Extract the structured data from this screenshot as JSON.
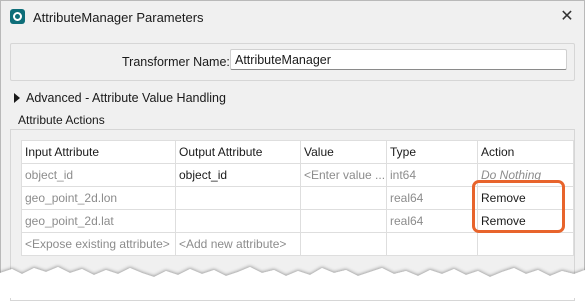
{
  "window": {
    "title": "AttributeManager Parameters",
    "close_glyph": "✕"
  },
  "transformer": {
    "label": "Transformer Name:",
    "value": "AttributeManager"
  },
  "advanced": {
    "label": "Advanced - Attribute Value Handling"
  },
  "attribute_actions": {
    "section_label": "Attribute Actions",
    "columns": [
      "Input Attribute",
      "Output Attribute",
      "Value",
      "Type",
      "Action"
    ],
    "rows": [
      {
        "input": "object_id",
        "output": "object_id",
        "value": "<Enter value ...",
        "type": "int64",
        "action": "Do Nothing"
      },
      {
        "input": "geo_point_2d.lon",
        "output": "",
        "value": "",
        "type": "real64",
        "action": "Remove"
      },
      {
        "input": "geo_point_2d.lat",
        "output": "",
        "value": "",
        "type": "real64",
        "action": "Remove"
      },
      {
        "input": "<Expose existing attribute>",
        "output": "<Add new attribute>",
        "value": "",
        "type": "",
        "action": ""
      }
    ]
  },
  "colors": {
    "highlight": "#e8642c",
    "icon": "#0e6e79"
  }
}
